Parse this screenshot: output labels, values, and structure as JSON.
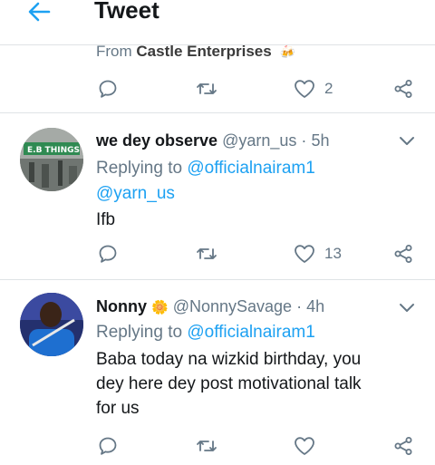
{
  "header": {
    "title": "Tweet",
    "back_icon": "arrow-left-icon"
  },
  "top_tweet_footer": {
    "from_label": "From",
    "from_name": "Castle Enterprises",
    "from_emoji": "🍻",
    "actions": {
      "reply_icon": "reply-icon",
      "retweet_icon": "retweet-icon",
      "like_icon": "heart-icon",
      "like_count": "2",
      "share_icon": "share-icon"
    }
  },
  "replies": [
    {
      "display_name": "we dey observe",
      "name_emoji": "",
      "handle": "@yarn_us",
      "separator": "·",
      "time": "5h",
      "replying_label": "Replying to",
      "replying_to": [
        "@officialnairam1",
        "@yarn_us"
      ],
      "body_lines": [
        "Ifb"
      ],
      "like_count": "13",
      "avatar_text": "E.B THINGS"
    },
    {
      "display_name": "Nonny",
      "name_emoji": "🌼",
      "handle": "@NonnySavage",
      "separator": "·",
      "time": "4h",
      "replying_label": "Replying to",
      "replying_to": [
        "@officialnairam1"
      ],
      "body_lines": [
        "Baba today na wizkid birthday, you",
        "dey here dey post motivational talk",
        "for us"
      ],
      "like_count": ""
    }
  ],
  "colors": {
    "accent": "#1da1f2",
    "secondary_text": "#657786",
    "primary_text": "#14171a",
    "divider": "#dfe3e6"
  }
}
